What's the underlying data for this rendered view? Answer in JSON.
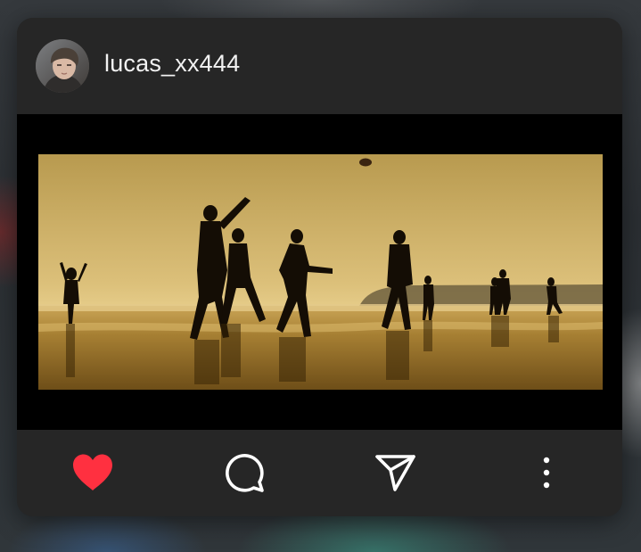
{
  "post": {
    "username": "lucas_xx444",
    "image_description_icon": "beach-football-photo"
  },
  "actions": {
    "like_icon": "heart-icon",
    "comment_icon": "comment-icon",
    "share_icon": "send-icon",
    "more_icon": "more-vertical-icon",
    "like_color": "#ff3040"
  },
  "colors": {
    "card_bg": "#262626",
    "text": "#f2f2f2",
    "media_bg": "#000000"
  }
}
